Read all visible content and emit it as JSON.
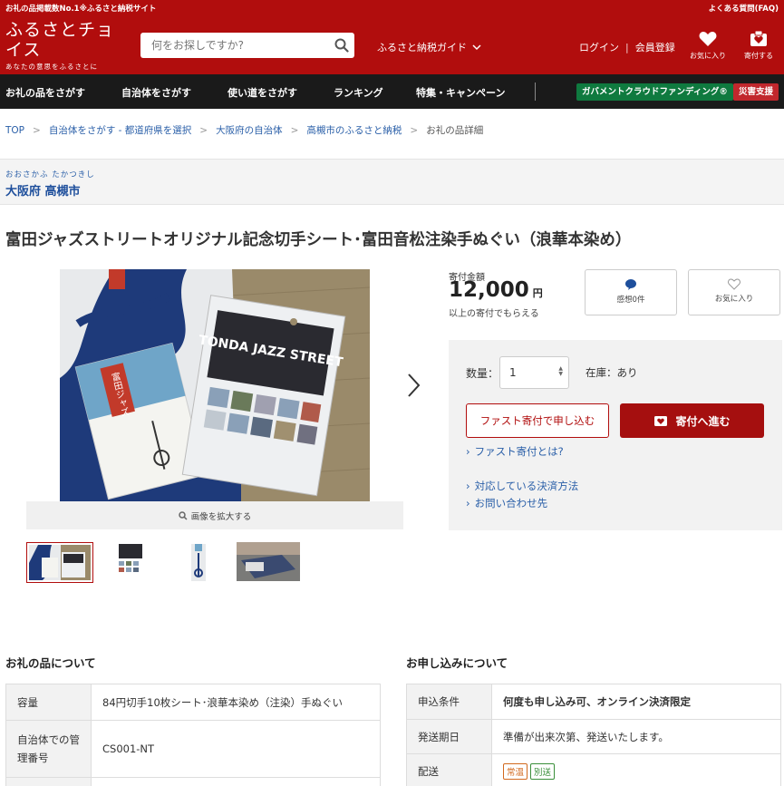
{
  "topstrip": {
    "left": "お礼の品掲載数No.1※ふるさと納税サイト",
    "right": "よくある質問(FAQ)"
  },
  "header": {
    "logo_main": "ふるさとチョイス",
    "logo_sub": "あなたの意思をふるさとに",
    "search_placeholder": "何をお探しですか?",
    "guide": "ふるさと納税ガイド",
    "login": "ログイン",
    "register": "会員登録",
    "favorites": "お気に入り",
    "donations": "寄付する"
  },
  "nav": {
    "items": [
      "お礼の品をさがす",
      "自治体をさがす",
      "使い道をさがす",
      "ランキング",
      "特集・キャンペーン"
    ],
    "gcf": "ガバメントクラウドファンディング®",
    "disaster": "災害支援"
  },
  "breadcrumb": [
    "TOP",
    "自治体をさがす - 都道府県を選択",
    "大阪府の自治体",
    "高槻市のふるさと納税",
    "お礼の品詳細"
  ],
  "municipality": {
    "kana": "おおさかふ たかつきし",
    "name": "大阪府 高槻市"
  },
  "product": {
    "title": "富田ジャズストリートオリジナル記念切手シート･富田音松注染手ぬぐい（浪華本染め）",
    "zoom_label": "画像を拡大する",
    "main_image_text": "TONDA JAZZ STREET",
    "main_image_side_text": "富田ジャズ"
  },
  "donation": {
    "amount_label": "寄付金額",
    "amount": "12,000",
    "yen": "円",
    "note": "以上の寄付でもらえる",
    "reviews": "感想0件",
    "favorite": "お気に入り",
    "qty_label": "数量：",
    "qty_value": "1",
    "stock": "在庫：あり",
    "fast_button": "ファスト寄付で申し込む",
    "donate_button": "寄付へ進む",
    "fast_what": "ファスト寄付とは?",
    "payment": "対応している決済方法",
    "contact": "お問い合わせ先"
  },
  "about": {
    "heading": "お礼の品について",
    "rows": [
      {
        "label": "容量",
        "value": "84円切手10枚シート･浪華本染め（注染）手ぬぐい"
      },
      {
        "label": "自治体での管理番号",
        "value": "CS001-NT"
      }
    ]
  },
  "apply": {
    "heading": "お申し込みについて",
    "rows": [
      {
        "label": "申込条件",
        "value": "何度も申し込み可、オンライン決済限定"
      },
      {
        "label": "発送期日",
        "value": "準備が出来次第、発送いたします。"
      },
      {
        "label": "配送",
        "value": ""
      }
    ],
    "tags": [
      "常温",
      "別送"
    ]
  },
  "colors": {
    "brand_red": "#b10d0d",
    "nav_bg": "#1a1a1a",
    "link_blue": "#2a5fa8",
    "gcf_green": "#0f7a3f",
    "tag_orange": "#d2691e",
    "tag_green": "#3a8f3a"
  }
}
